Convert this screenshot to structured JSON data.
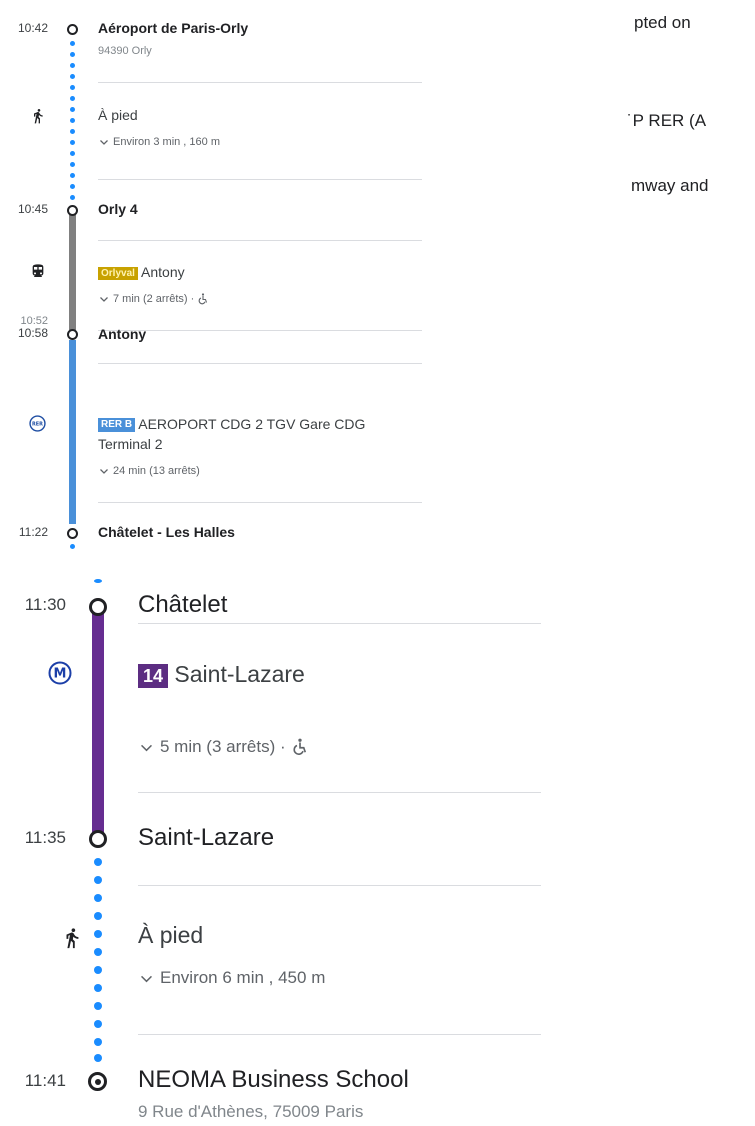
{
  "top": {
    "stops": {
      "orly": {
        "time": "10:42",
        "name": "Aéroport de Paris-Orly",
        "address": "94390 Orly"
      },
      "orly4": {
        "time": "10:45",
        "name": "Orly 4"
      },
      "antony": {
        "time_old": "10:52",
        "time": "10:58",
        "name": "Antony"
      },
      "chatelet_lh": {
        "time": "11:22",
        "name": "Châtelet - Les Halles"
      }
    },
    "walk1": {
      "label": "À pied",
      "details": "Environ 3 min , 160 m"
    },
    "orlyval": {
      "badge": "Orlyval",
      "badge_color": "#c8a200",
      "destination": "Antony",
      "details": "7 min (2 arrêts) ·",
      "line_color": "#808080"
    },
    "rerb": {
      "badge": "RER B",
      "badge_color": "#4a90d9",
      "destination": "AEROPORT CDG 2 TGV Gare CDG Terminal 2",
      "details": "24 min (13 arrêts)",
      "line_color": "#4a90d9",
      "icon_text": "RER"
    }
  },
  "bottom": {
    "stops": {
      "chatelet": {
        "time": "11:30",
        "name": "Châtelet"
      },
      "saint_lazare": {
        "time": "11:35",
        "name": "Saint-Lazare"
      },
      "neoma": {
        "time": "11:41",
        "name": "NEOMA Business School",
        "address": "9 Rue d'Athènes, 75009 Paris"
      }
    },
    "metro14": {
      "badge": "14",
      "badge_color": "#5c2d82",
      "destination": "Saint-Lazare",
      "details": "5 min (3 arrêts) ·",
      "line_color": "#662d91",
      "icon_text": "M"
    },
    "walk2": {
      "label": "À pied",
      "details": "Environ 6 min , 450 m"
    }
  },
  "right_fragments": [
    "pted on",
    "˙P RER (A",
    "mway and"
  ],
  "colors": {
    "walk_dot": "#1a8cff"
  },
  "icons": {
    "walk": "walking-person-icon",
    "tram": "tram-icon",
    "rer": "rer-icon",
    "metro": "metro-icon",
    "chevron": "chevron-down-icon",
    "accessible": "wheelchair-icon"
  }
}
